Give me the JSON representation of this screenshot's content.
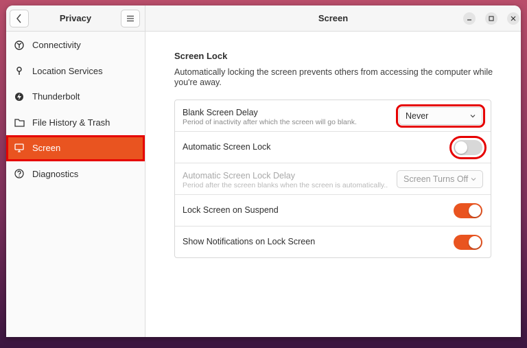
{
  "sidebar": {
    "title": "Privacy",
    "back_icon": "chevron-left-icon",
    "menu_icon": "hamburger-menu-icon",
    "items": [
      {
        "label": "Connectivity",
        "icon": "connectivity-icon"
      },
      {
        "label": "Location Services",
        "icon": "location-pin-icon"
      },
      {
        "label": "Thunderbolt",
        "icon": "thunderbolt-icon"
      },
      {
        "label": "File History & Trash",
        "icon": "folder-icon"
      },
      {
        "label": "Screen",
        "icon": "monitor-icon",
        "active": true
      },
      {
        "label": "Diagnostics",
        "icon": "question-icon"
      }
    ]
  },
  "main": {
    "title": "Screen",
    "window_controls": [
      "minimize-icon",
      "maximize-icon",
      "close-icon"
    ],
    "section": {
      "title": "Screen Lock",
      "description": "Automatically locking the screen prevents others from accessing the computer while you're away."
    },
    "rows": [
      {
        "label": "Blank Screen Delay",
        "sublabel": "Period of inactivity after which the screen will go blank.",
        "control": "dropdown",
        "value": "Never"
      },
      {
        "label": "Automatic Screen Lock",
        "control": "toggle",
        "on": false
      },
      {
        "label": "Automatic Screen Lock Delay",
        "sublabel": "Period after the screen blanks when the screen is automatically...",
        "control": "dropdown",
        "value": "Screen Turns Off",
        "disabled": true
      },
      {
        "label": "Lock Screen on Suspend",
        "control": "toggle",
        "on": true
      },
      {
        "label": "Show Notifications on Lock Screen",
        "control": "toggle",
        "on": true
      }
    ]
  },
  "colors": {
    "accent": "#e95420",
    "highlight": "#e60000"
  }
}
